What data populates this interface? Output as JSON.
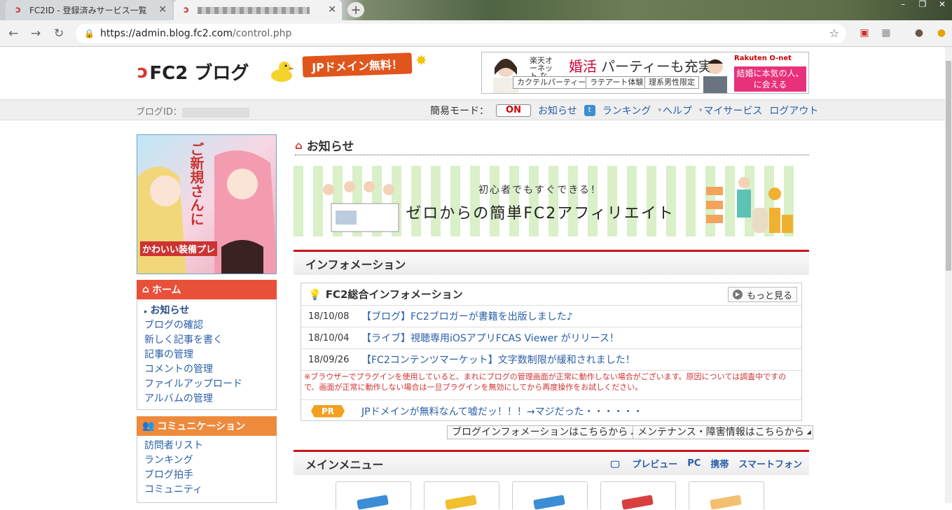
{
  "browser": {
    "tabs": [
      {
        "title": "FC2ID - 登録済みサービス一覧",
        "active": false
      },
      {
        "title": "",
        "active": true
      }
    ],
    "url_host": "https://admin.blog.fc2.com",
    "url_path": "/control.php",
    "win_minimize": "–",
    "win_restore": "❐",
    "win_close": "✕"
  },
  "header": {
    "logo_text": "FC2 ブログ",
    "jp_banner": "JPドメイン無料！",
    "ad": {
      "line1": "楽天オーネット なら",
      "big1": "婚活",
      "big2": "パーティーも充実",
      "tags": [
        "カクテルパーティー",
        "ラテアート体験",
        "理系男性限定"
      ],
      "brand": "Rakuten O-net",
      "cta": "結婚に本気の人、に会える"
    }
  },
  "band": {
    "blog_id_label": "ブログID：",
    "easy_mode_label": "簡易モード：",
    "easy_mode_value": "ON",
    "nav": [
      "お知らせ",
      "ランキング",
      "ヘルプ",
      "マイサービス",
      "ログアウト"
    ]
  },
  "sidebar": {
    "image_text": "ご新規さんに",
    "image_text2": "かわいい装備プレ",
    "home_title": "ホーム",
    "home_items": [
      "お知らせ",
      "ブログの確認",
      "新しく記事を書く",
      "記事の管理",
      "コメントの管理",
      "ファイルアップロード",
      "アルバムの管理"
    ],
    "comm_title": "コミュニケーション",
    "comm_items": [
      "訪問者リスト",
      "ランキング",
      "ブログ拍手",
      "コミュニティ"
    ]
  },
  "main": {
    "notice_title": "お知らせ",
    "affiliate_sub": "初心者でもすぐできる！",
    "affiliate_main": "ゼロからの簡単FC2アフィリエイト",
    "info_section": "インフォメーション",
    "info_box_title": "FC2総合インフォメーション",
    "more_label": "もっと見る",
    "news": [
      {
        "date": "18/10/08",
        "text": "【ブログ】FC2ブロガーが書籍を出版しました♪"
      },
      {
        "date": "18/10/04",
        "text": "【ライブ】視聴専用iOSアプリFCAS Viewer がリリース！"
      },
      {
        "date": "18/09/26",
        "text": "【FC2コンテンツマーケット】文字数制限が緩和されました！"
      }
    ],
    "warning": "※ブラウザーでプラグインを使用していると、まれにブログの管理画面が正常に動作しない場合がございます。原因については調査中ですので、画面が正常に動作しない場合は一旦プラグインを無効にしてから再度操作をお試しください。",
    "pr_label": "PR",
    "pr_text": "JPドメインが無料なんて嘘だッ！！！→マジだった・・・・・・",
    "blog_info_link": "ブログインフォメーションはこちらから",
    "maint_link": "メンテナンス・障害情報はこちらから",
    "menu_section": "メインメニュー",
    "preview_label": "プレビュー",
    "preview_targets": [
      "PC",
      "携帯",
      "スマートフォン"
    ]
  },
  "colors": {
    "accent_red": "#c8161d",
    "home_head": "#e8503a",
    "comm_head": "#ee8a3c",
    "link": "#2a5fa8"
  }
}
